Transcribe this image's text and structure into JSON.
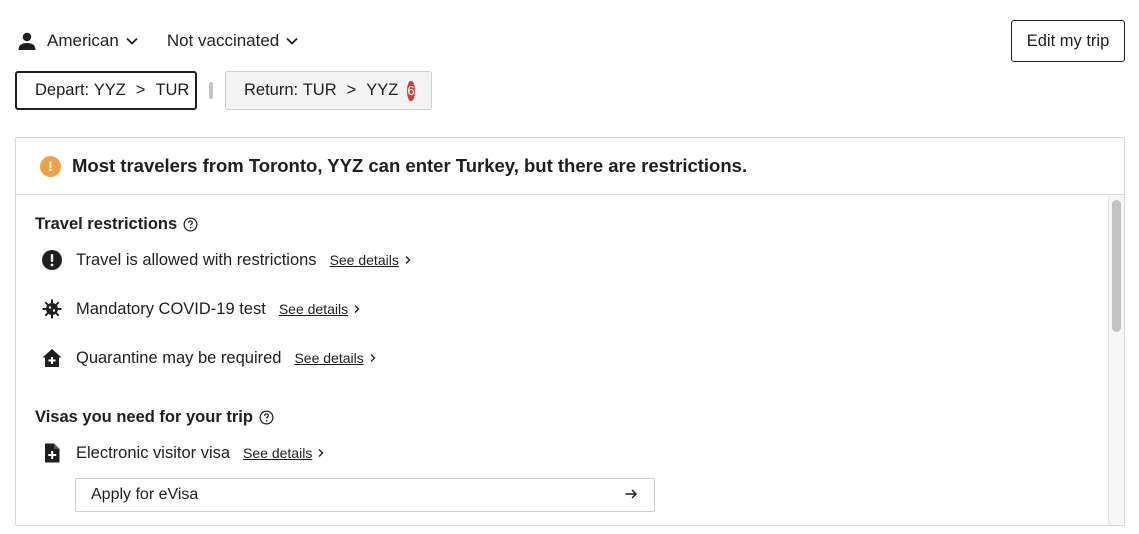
{
  "filters": {
    "nationality": "American",
    "vaccination": "Not vaccinated"
  },
  "edit_trip_label": "Edit my trip",
  "trip_tabs": {
    "depart_prefix": "Depart:",
    "depart_from": "YYZ",
    "depart_to": "TUR",
    "return_prefix": "Return:",
    "return_from": "TUR",
    "return_to": "YYZ",
    "return_badge": "6",
    "arrow": ">"
  },
  "summary": {
    "icon": "!",
    "text": "Most travelers from Toronto, YYZ can enter Turkey, but there are restrictions."
  },
  "travel_restrictions": {
    "title": "Travel restrictions",
    "items": [
      {
        "icon": "exclamation-circle-icon",
        "text": "Travel is allowed with restrictions",
        "link": "See details"
      },
      {
        "icon": "virus-icon",
        "text": "Mandatory COVID-19 test",
        "link": "See details"
      },
      {
        "icon": "house-plus-icon",
        "text": "Quarantine may be required",
        "link": "See details"
      }
    ]
  },
  "visas": {
    "title": "Visas you need for your trip",
    "items": [
      {
        "icon": "document-plus-icon",
        "text": "Electronic visitor visa",
        "link": "See details"
      }
    ],
    "apply_label": "Apply for eVisa"
  },
  "colors": {
    "warning": "#f0a04b",
    "badge": "#d93b3b",
    "text": "#1f1f1f"
  }
}
